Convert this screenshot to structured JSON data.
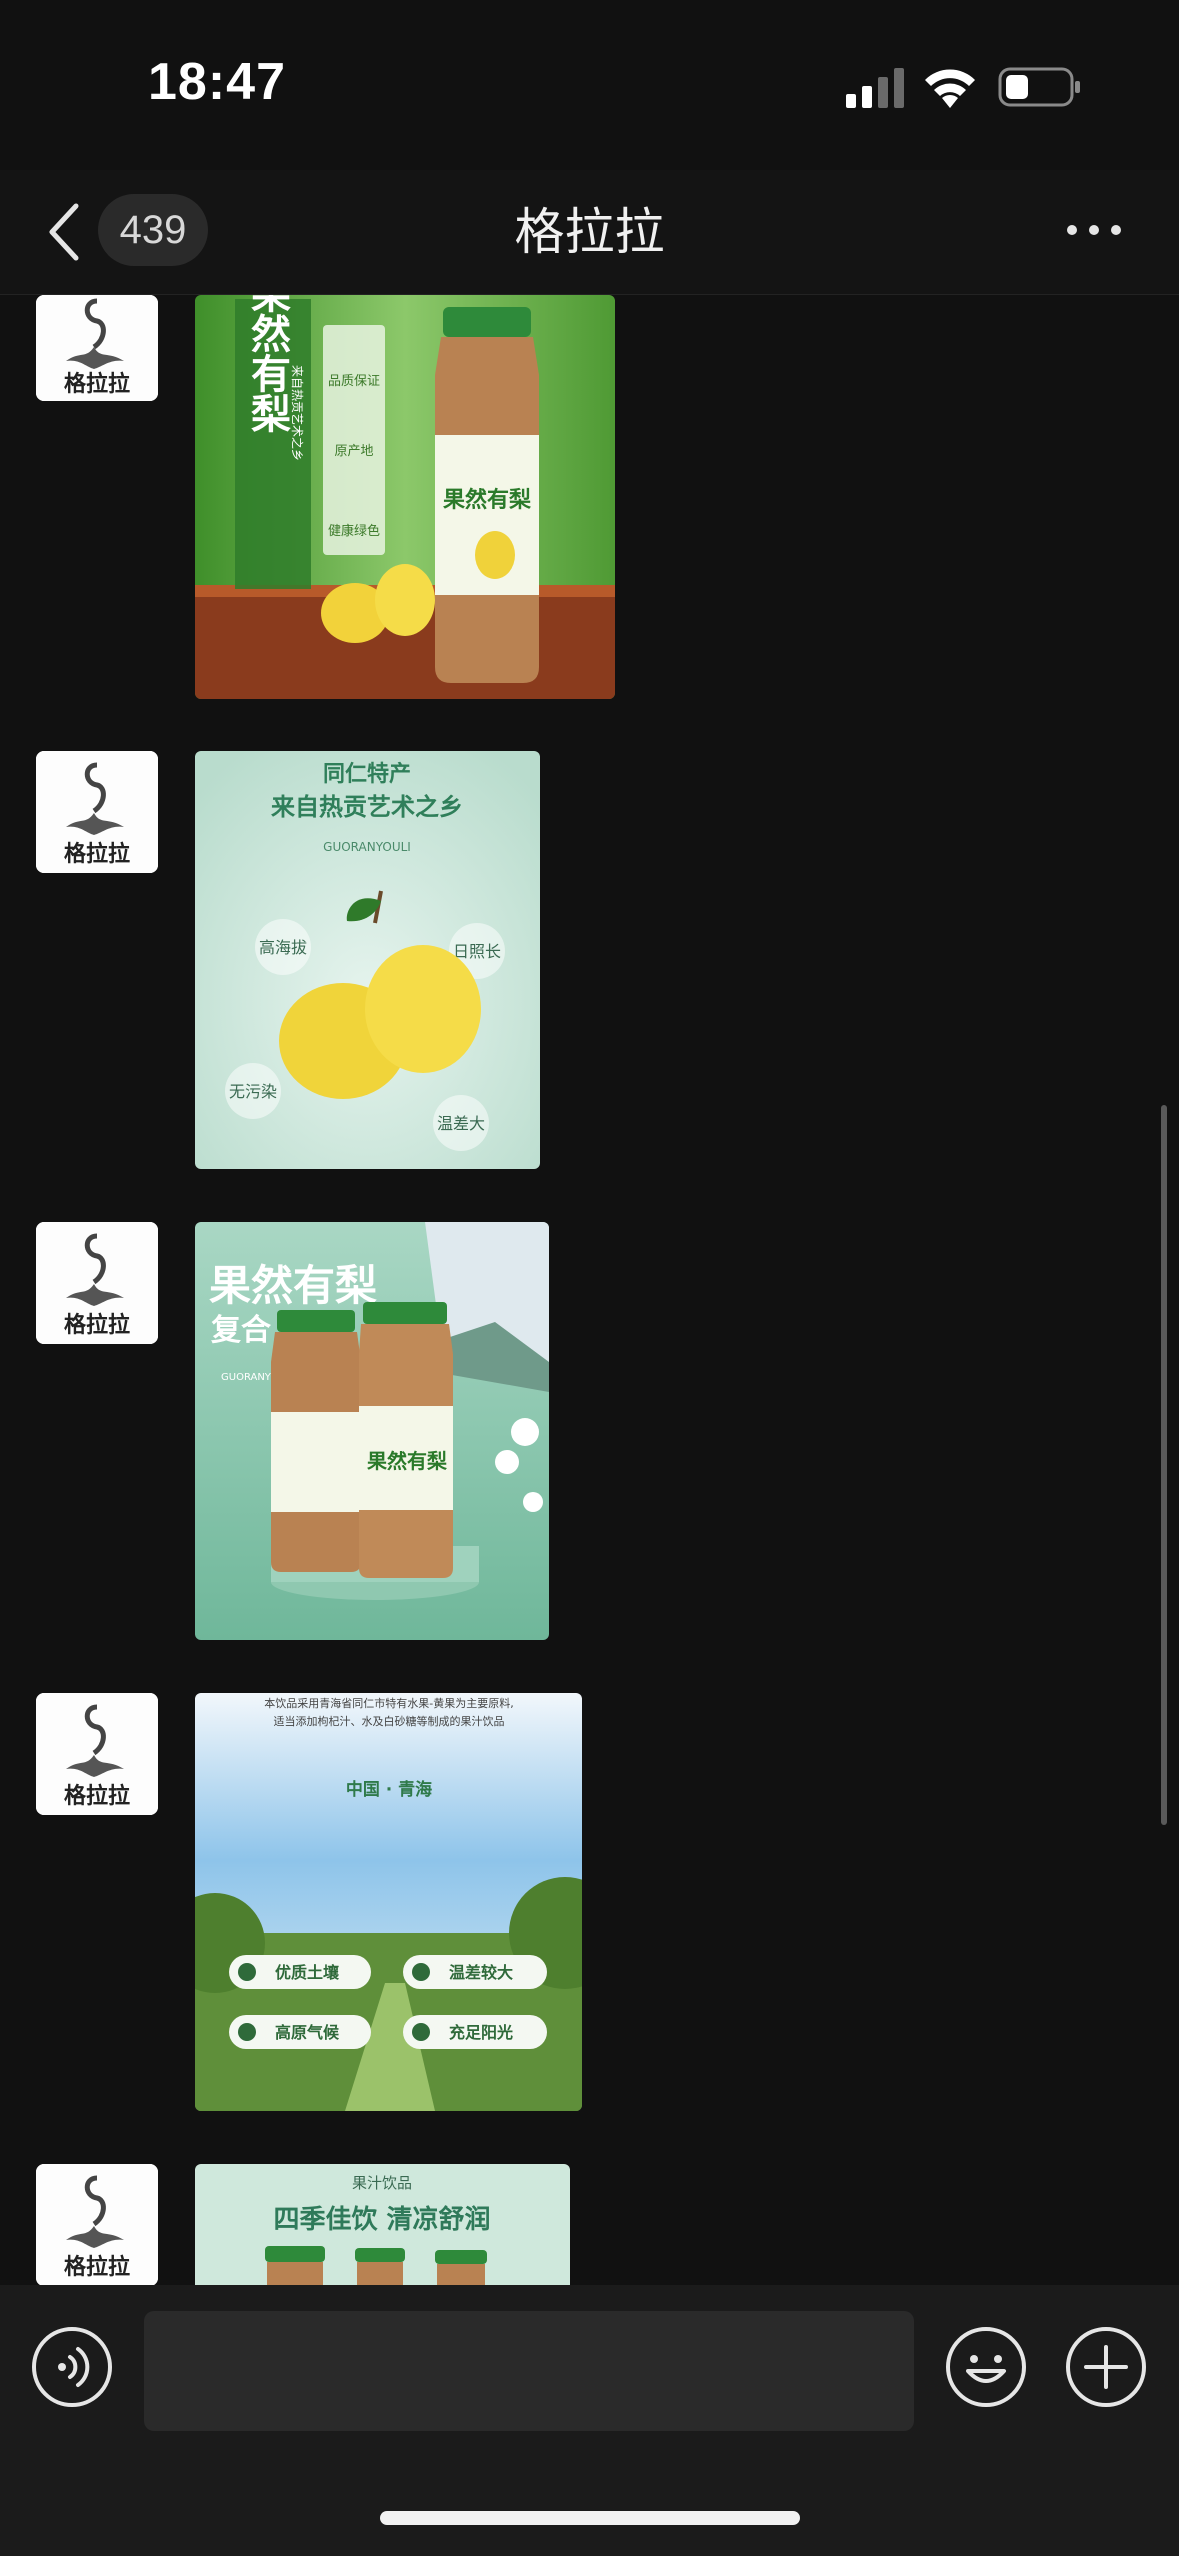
{
  "status": {
    "time": "18:47"
  },
  "nav": {
    "unread_count": "439",
    "title": "格拉拉"
  },
  "avatar": {
    "label": "格拉拉"
  },
  "messages": [
    {
      "type": "image",
      "title_vertical": "果然有梨",
      "subtitle": "来自热贡艺术之乡",
      "badges": [
        "品质保证",
        "原产地",
        "健康绿色"
      ],
      "bottle_label": "果然有梨"
    },
    {
      "type": "image",
      "line1": "同仁特产",
      "line2": "来自热贡艺术之乡",
      "brand": "GUORANYOULI",
      "tags": [
        "高海拔",
        "日照长",
        "无污染",
        "温差大"
      ]
    },
    {
      "type": "image",
      "title": "果然有梨",
      "subtitle": "复合",
      "brand": "GUORANYO",
      "bottle_label": "果然有梨"
    },
    {
      "type": "image",
      "desc1": "本饮品采用青海省同仁市特有水果-黄果为主要原料,",
      "desc2": "适当添加枸杞汁、水及白砂糖等制成的果汁饮品",
      "place": "中国 · 青海",
      "features": [
        "优质土壤",
        "温差较大",
        "高原气候",
        "充足阳光"
      ]
    },
    {
      "type": "image",
      "small": "果汁饮品",
      "headline": "四季佳饮 清凉舒润"
    }
  ],
  "colors": {
    "background": "#111111",
    "accent_green": "#2f8a3a",
    "mint": "#cfe8dc"
  }
}
